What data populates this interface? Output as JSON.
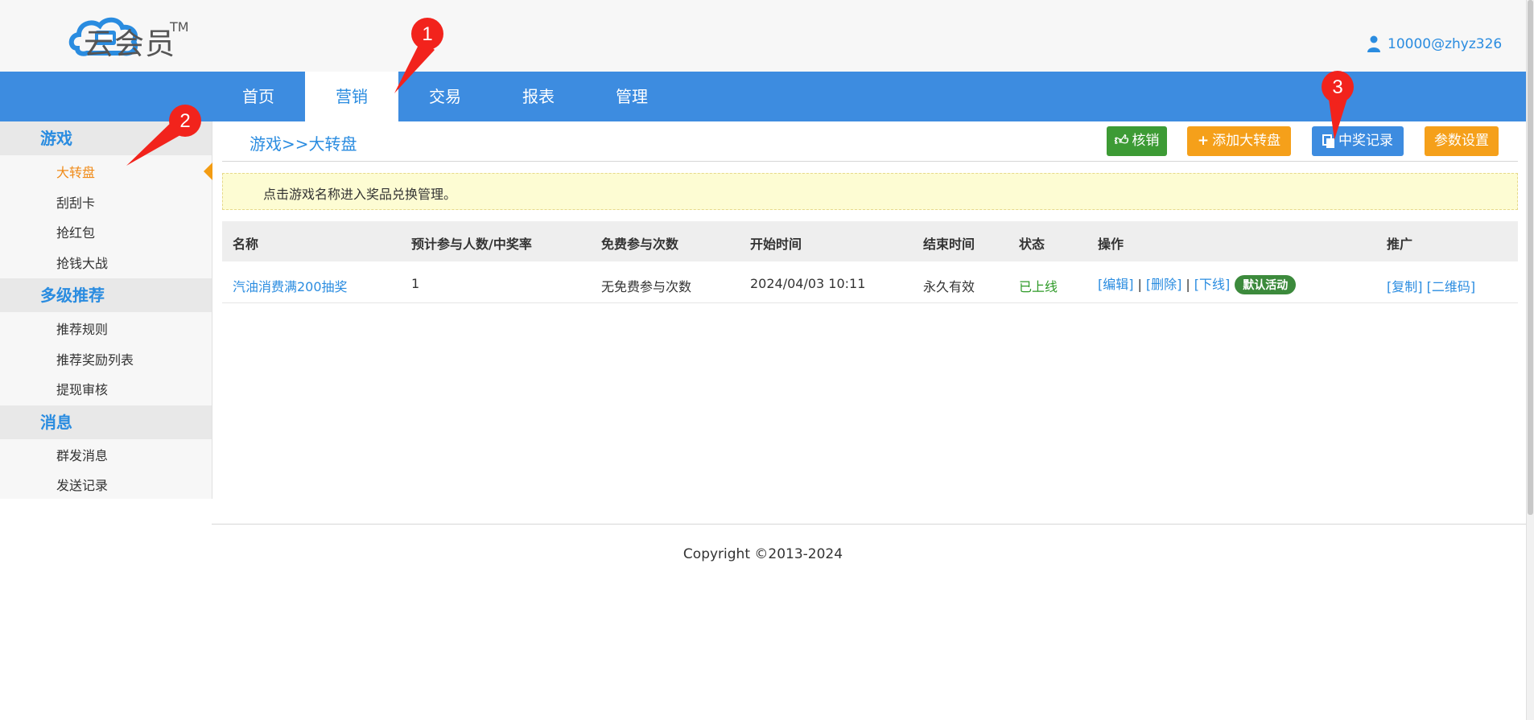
{
  "app": {
    "logo_text": "云会员",
    "logo_tm": "TM",
    "user": "10000@zhyz326"
  },
  "nav": {
    "items": [
      "首页",
      "营销",
      "交易",
      "报表",
      "管理"
    ],
    "active": "营销"
  },
  "sidebar": {
    "sections": [
      {
        "title": "游戏",
        "items": [
          "大转盘",
          "刮刮卡",
          "抢红包",
          "抢钱大战"
        ]
      },
      {
        "title": "多级推荐",
        "items": [
          "推荐规则",
          "推荐奖励列表",
          "提现审核"
        ]
      },
      {
        "title": "消息",
        "items": [
          "群发消息",
          "发送记录"
        ]
      }
    ],
    "active_item": "大转盘"
  },
  "content": {
    "breadcrumb": "游戏>>大转盘",
    "buttons": {
      "verify": "核销",
      "add": "添加大转盘",
      "records": "中奖记录",
      "params": "参数设置"
    },
    "notice": "点击游戏名称进入奖品兑换管理。"
  },
  "table": {
    "headers": [
      "名称",
      "预计参与人数/中奖率",
      "免费参与次数",
      "开始时间",
      "结束时间",
      "状态",
      "操作",
      "推广"
    ],
    "rows": [
      {
        "name": "汽油消费满200抽奖",
        "expected": "1",
        "free_times": "无免费参与次数",
        "start": "2024/04/03 10:11",
        "end": "永久有效",
        "status": "已上线",
        "actions": [
          "[编辑]",
          "[删除]",
          "[下线]"
        ],
        "separator": "|",
        "badge": "默认活动",
        "promo": [
          "[复制]",
          "[二维码]"
        ]
      }
    ]
  },
  "footer": {
    "copyright": "Copyright ©2013-2024"
  },
  "annotations": [
    "1",
    "2",
    "3"
  ],
  "colors": {
    "primary": "#3d8ce0",
    "orange": "#f5a01a",
    "green": "#3d9b35",
    "annotation_red": "#f2231c"
  }
}
